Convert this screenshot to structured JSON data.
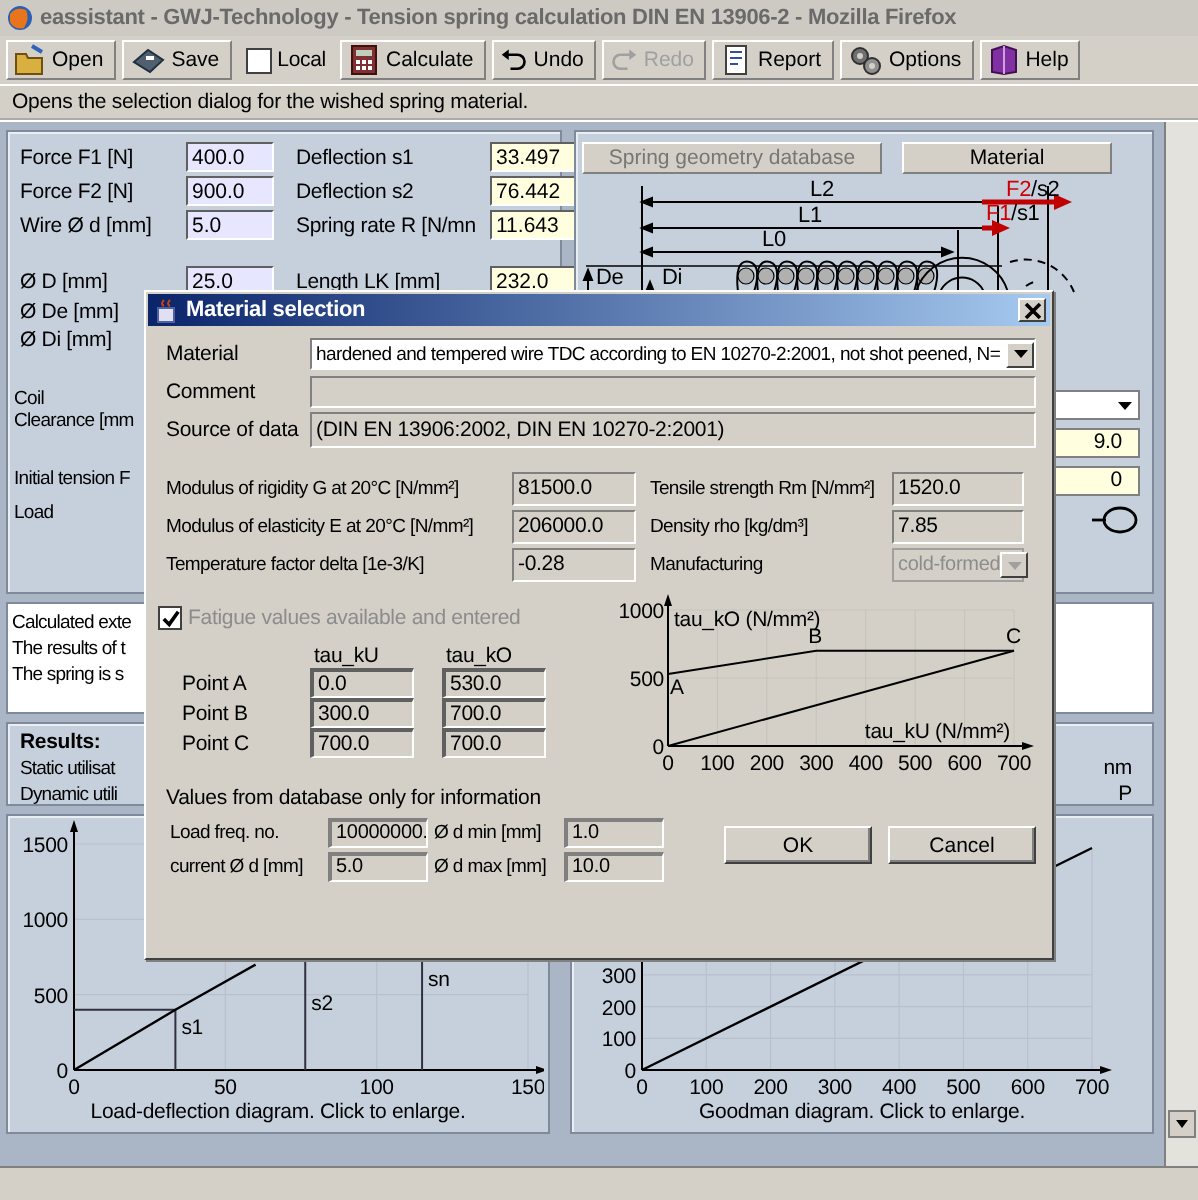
{
  "window": {
    "title": "eassistant - GWJ-Technology - Tension spring calculation DIN EN 13906-2 - Mozilla Firefox"
  },
  "toolbar": [
    {
      "kind": "open",
      "label": "Open",
      "disabled": false
    },
    {
      "kind": "save",
      "label": "Save",
      "disabled": false
    },
    {
      "kind": "checkbox",
      "label": "Local",
      "checked": false
    },
    {
      "kind": "calculate",
      "label": "Calculate",
      "disabled": false
    },
    {
      "kind": "undo",
      "label": "Undo",
      "disabled": false
    },
    {
      "kind": "redo",
      "label": "Redo",
      "disabled": true
    },
    {
      "kind": "report",
      "label": "Report",
      "disabled": false
    },
    {
      "kind": "options",
      "label": "Options",
      "disabled": false
    },
    {
      "kind": "help",
      "label": "Help",
      "disabled": false
    }
  ],
  "hint": "Opens the selection dialog for the wished spring material.",
  "form": {
    "rows": [
      {
        "label": "Force F1 [N]",
        "value": "400.0",
        "result_label": "Deflection s1",
        "result": "33.497"
      },
      {
        "label": "Force F2 [N]",
        "value": "900.0",
        "result_label": "Deflection s2",
        "result": "76.442"
      },
      {
        "label": "Wire Ø d [mm]",
        "value": "5.0",
        "result_label": "Spring rate R [N/mn",
        "result": "11.643"
      }
    ],
    "rows_2": [
      {
        "label": "Ø D [mm]",
        "value": "25.0",
        "result_label": "Length LK [mm]",
        "result": "232.0"
      },
      {
        "label": "Ø De [mm]"
      },
      {
        "label": "Ø Di [mm]"
      }
    ],
    "labels": [
      "Coil",
      "Clearance [mm",
      "Initial tension F",
      "Load"
    ]
  },
  "geometry": {
    "buttons": [
      {
        "label": "Spring geometry database",
        "disabled": true
      },
      {
        "label": "Material",
        "disabled": false
      }
    ],
    "lengths": [
      "L2",
      "L1",
      "L0"
    ],
    "forces": [
      {
        "force": "F2",
        "deflection": "/s2"
      },
      {
        "force": "F1",
        "deflection": "/s1"
      }
    ],
    "diameters": [
      "De",
      "Di"
    ],
    "fields": [
      "9.0",
      "0"
    ]
  },
  "messages": [
    "Calculated exte",
    "The results of t",
    "The spring is s"
  ],
  "results": {
    "title": "Results:",
    "lines": [
      "Static utilisat",
      "Dynamic utili"
    ],
    "right": [
      "nm",
      "P"
    ]
  },
  "charts": [
    {
      "chart_data": {
        "type": "line",
        "xlabel": "Load-deflection diagram. Click to enlarge.",
        "x": [
          0,
          33.5,
          60
        ],
        "xlim": [
          0,
          150
        ],
        "ylim": [
          0,
          1500
        ],
        "xticks": [
          0,
          50,
          100,
          150
        ],
        "yticks": [
          0,
          500,
          1000,
          1500
        ],
        "grid": true,
        "series": [
          {
            "color": "#000000",
            "values": [
              0,
              400,
              700
            ]
          }
        ],
        "ref_lines": [
          {
            "axis": "x",
            "value": 33.5,
            "label": "s1"
          },
          {
            "axis": "x",
            "value": 76.4,
            "label": "s2"
          },
          {
            "axis": "x",
            "value": 115,
            "label": "sn"
          }
        ]
      }
    },
    {
      "chart_data": {
        "type": "line",
        "xlabel": "Goodman diagram. Click to enlarge.",
        "x": [
          0,
          700
        ],
        "xlim": [
          0,
          700
        ],
        "ylim": [
          0,
          700
        ],
        "xticks": [
          0,
          100,
          200,
          300,
          400,
          500,
          600,
          700
        ],
        "yticks": [
          0,
          100,
          200,
          300
        ],
        "grid": true,
        "series": [
          {
            "color": "#000000",
            "values": [
              0,
              700
            ]
          }
        ]
      }
    }
  ],
  "dialog": {
    "title": "Material selection",
    "material": {
      "label": "Material",
      "value": "hardened and tempered wire TDC according to EN 10270-2:2001, not shot peened, N="
    },
    "comment": {
      "label": "Comment"
    },
    "source": {
      "label": "Source of data",
      "value": "(DIN EN 13906:2002, DIN EN 10270-2:2001)"
    },
    "properties": [
      {
        "label": "Modulus of rigidity G at 20°C [N/mm²]",
        "value": "81500.0",
        "label_2": "Tensile strength Rm [N/mm²]",
        "value_2": "1520.0"
      },
      {
        "label": "Modulus of elasticity E at 20°C [N/mm²]",
        "value": "206000.0",
        "label_2": "Density rho [kg/dm³]",
        "value_2": "7.85"
      },
      {
        "label": "Temperature factor delta [1e-3/K]",
        "value": "-0.28",
        "label_2": "Manufacturing",
        "value_2": "cold-formed",
        "disabled": true
      }
    ],
    "fatigue": {
      "label": "Fatigue values available and entered",
      "checked": true,
      "disabled": true
    },
    "fatigue_table": {
      "columns": [
        "tau_kU",
        "tau_kO"
      ],
      "rows": [
        {
          "label": "Point A",
          "values": [
            "0.0",
            "530.0"
          ]
        },
        {
          "label": "Point B",
          "values": [
            "300.0",
            "700.0"
          ]
        },
        {
          "label": "Point C",
          "values": [
            "700.0",
            "700.0"
          ]
        }
      ]
    },
    "chart_data": {
      "type": "line",
      "xlabel": "tau_kU (N/mm²)",
      "ylabel": "tau_kO (N/mm²)",
      "x": [
        0,
        300,
        700
      ],
      "xlim": [
        0,
        700
      ],
      "ylim": [
        0,
        1000
      ],
      "xticks": [
        0,
        100,
        200,
        300,
        400,
        500,
        600,
        700
      ],
      "yticks": [
        0,
        500,
        1000
      ],
      "grid": true,
      "series": [
        {
          "color": "#000000",
          "values": [
            530,
            700,
            700
          ]
        },
        {
          "color": "#000000",
          "values": [
            0,
            300,
            700
          ]
        }
      ],
      "annotations": [
        {
          "x": 0,
          "y": 530,
          "text": "A"
        },
        {
          "x": 300,
          "y": 700,
          "text": "B"
        },
        {
          "x": 700,
          "y": 700,
          "text": "C"
        }
      ]
    },
    "info": {
      "title": "Values from database only for information",
      "fields": [
        {
          "label": "Load freq. no.",
          "value": "10000000."
        },
        {
          "label": "Ø d min [mm]",
          "value": "1.0"
        },
        {
          "label": "current  Ø d [mm]",
          "value": "5.0"
        },
        {
          "label": "Ø d max [mm]",
          "value": "10.0"
        }
      ]
    },
    "buttons": [
      "OK",
      "Cancel"
    ]
  }
}
